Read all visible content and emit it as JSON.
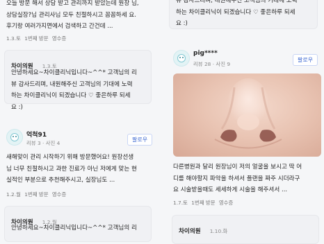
{
  "left": {
    "review1": {
      "lines": [
        "오늘 방문 해서 상담 받고 관리까지 받았는데 원장 님,",
        "상담실장?님 관리사님 모두 친절하시고 꼼꼼하세 요.",
        "후기랑 여러가지면에서 검색하고 간건데 ..."
      ],
      "meta": [
        "1.3.토",
        "1번째 방문",
        "영수증"
      ]
    },
    "reply1": {
      "shop": "차이의원",
      "date": "1.3.토",
      "lines": [
        "안녕하세요~차이클리닉입니다~^^* 고객님의 리",
        "뷰 감사드리며, 내원해주신 고객님의 기대에 노력",
        "하는 차이클리닉이 되겠습니다 ♡ 좋은하루 되세",
        "요 :)"
      ]
    },
    "user2": {
      "name": "억척91",
      "stats": "리뷰 3 · 사진 4",
      "follow": "팔로우"
    },
    "review2": {
      "lines": [
        "새해맞이 관리 시작하기 위해 방문했어요! 원장선생",
        "님 너무 친절하시고 과한 진료가 아닌 저에게 맞는 현",
        "실적인 부분으로 추천해주시고, 실장님도 ..."
      ],
      "meta": [
        "1.2.월",
        "1번째 방문",
        "영수증"
      ]
    },
    "reply2": {
      "shop": "차이의원",
      "date": "1.2.월",
      "lines": [
        "안녕하세요~차이클리닉입니다~^^* 고객님의 리"
      ]
    }
  },
  "right": {
    "reply_top": {
      "lines": [
        "뷰 감사드리며, 내원해주신 고객님의 기대에 노력",
        "하는 차이클리닉이 되겠습니다 ♡ 좋은하루 되세",
        "요 :)"
      ]
    },
    "user": {
      "name": "pig****",
      "stats": "리뷰 28 · 사진 9",
      "follow": "팔로우"
    },
    "review": {
      "lines": [
        "다른병원과 달리 원장님이 저의 얼굴을 보시고 딱 어",
        "디를 해야할지 파악을 하셔서 플랜을 짜주 시더라구",
        "요 시술받을때도 세세하게 시술을 해주셔서 ..."
      ],
      "meta": [
        "1.7.토",
        "1번째 방문",
        "영수증"
      ]
    },
    "reply": {
      "shop": "차이의원",
      "date": "1.10.화"
    }
  }
}
